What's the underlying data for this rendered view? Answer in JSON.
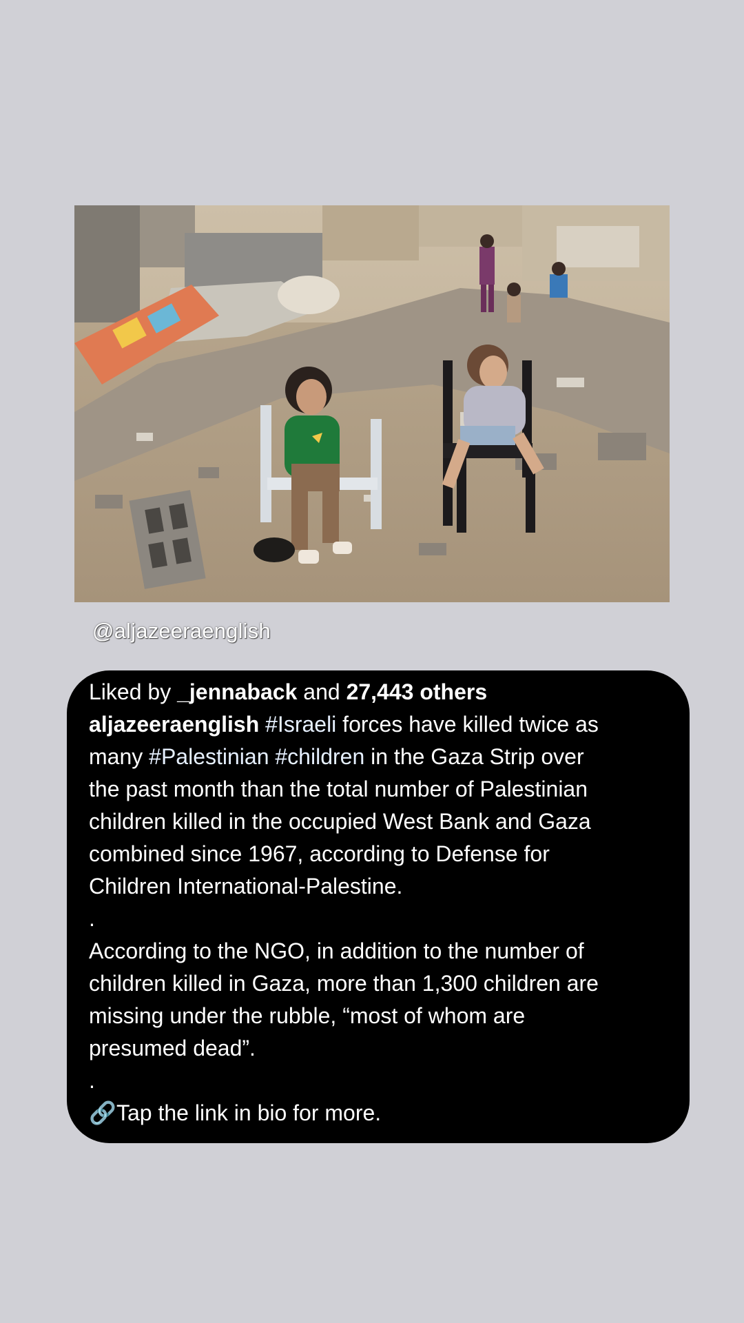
{
  "story": {
    "mention": "@aljazeeraenglish"
  },
  "caption": {
    "likes_prefix": "Liked by ",
    "liked_user": "_jennaback",
    "likes_middle": " and ",
    "likes_count": "27,443 others",
    "author": "aljazeeraenglish",
    "line1_tag": "#Israeli",
    "line1_rest": " forces have killed twice as",
    "line2_a": "many ",
    "line2_tag1": "#Palestinian",
    "line2_sp": " ",
    "line2_tag2": "#children",
    "line2_rest": " in the Gaza Strip over",
    "line3": "the past month than the total number of Palestinian",
    "line4": "children killed in the occupied West Bank and Gaza",
    "line5": "combined since 1967, according to Defense for",
    "line6": "Children International-Palestine.",
    "dot1": ".",
    "line7": "According to the NGO, in addition to the number of",
    "line8": "children killed in Gaza, more than 1,300 children are",
    "line9": "missing under the rubble, “most of whom are",
    "line10": "presumed dead”.",
    "dot2": ".",
    "link_icon": "🔗",
    "link_text": "Tap the link in bio for more."
  },
  "colors": {
    "background": "#d0d0d6",
    "card": "#000000",
    "text": "#ffffff"
  },
  "icons": {
    "link": "link-icon"
  }
}
